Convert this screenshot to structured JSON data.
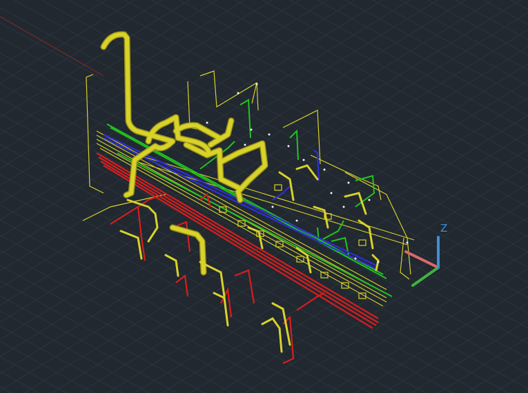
{
  "viewport": {
    "background": "#212830",
    "grid_color": "#2c343d",
    "grid_visible": true,
    "visual_style": "3D wireframe / realistic pipes"
  },
  "colors": {
    "yellow_pipe": "#d8d22a",
    "yellow_dark": "#9b9418",
    "red_pipe": "#d81e1e",
    "green_pipe": "#22c41f",
    "blue_pipe": "#2f2fd6",
    "white_node": "#f2f2f2"
  },
  "ucs_icon": {
    "z_label": "Z",
    "x_axis_color": "#d96a6a",
    "y_axis_color": "#3fb33f",
    "z_axis_color": "#3f8fd8",
    "icon_name": "ucs-axis-icon"
  },
  "model": {
    "name": "pipe-network-3d-model",
    "icon_name": "piping-assembly-icon"
  }
}
